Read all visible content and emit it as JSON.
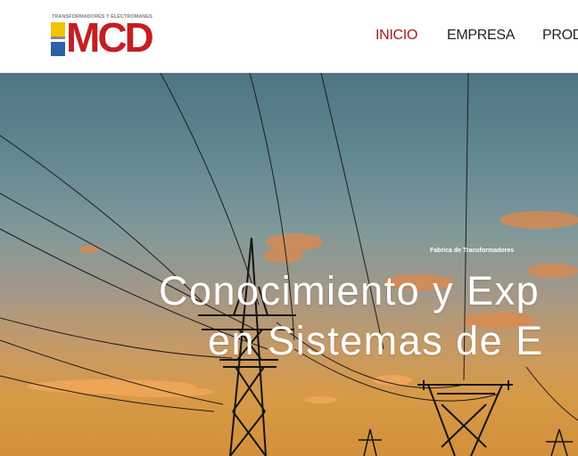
{
  "header": {
    "logo": {
      "tagline": "TRANSFORMADORES Y ELECTROMANES",
      "wordmark": "MCD"
    },
    "nav": [
      {
        "label": "INICIO",
        "active": true
      },
      {
        "label": "EMPRESA",
        "active": false
      },
      {
        "label": "PROD",
        "active": false
      }
    ]
  },
  "hero": {
    "kicker": "Fabrica de Transformadores",
    "headline_line1": "Conocimiento y Exp",
    "headline_line2": "en Sistemas de E"
  },
  "colors": {
    "brand_red": "#c41e23",
    "nav_active": "#a01c22",
    "logo_yellow": "#f3c400",
    "logo_blue": "#2f5fa8"
  }
}
